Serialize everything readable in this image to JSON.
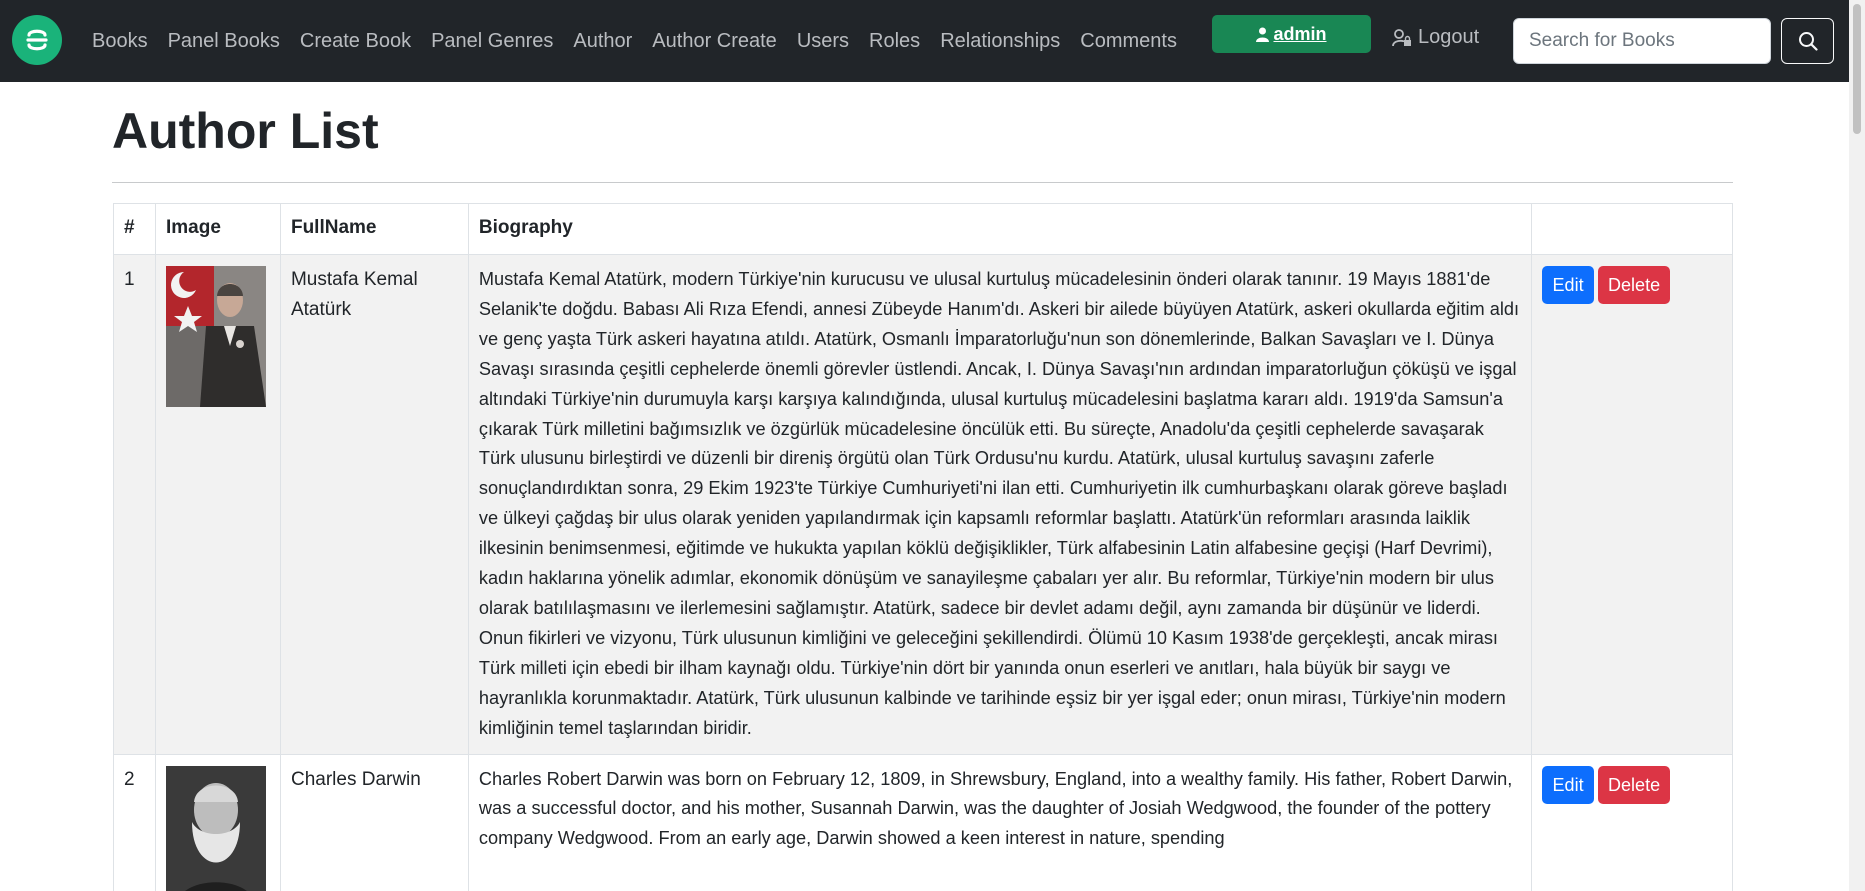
{
  "nav": {
    "brand_icon": "brand-logo-icon",
    "links": [
      "Books",
      "Panel Books",
      "Create Book",
      "Panel Genres",
      "Author",
      "Author Create",
      "Users",
      "Roles",
      "Relationships",
      "Comments"
    ],
    "admin_label": "admin",
    "logout_label": "Logout",
    "search_placeholder": "Search for Books"
  },
  "colors": {
    "navbar": "#212529",
    "brand": "#1ab37a",
    "admin": "#198754",
    "edit": "#0d6efd",
    "delete": "#dc3545"
  },
  "page": {
    "title": "Author List"
  },
  "table": {
    "headers": [
      "#",
      "Image",
      "FullName",
      "Biography",
      ""
    ],
    "rows": [
      {
        "num": "1",
        "name": "Mustafa Kemal Atatürk",
        "bio": "Mustafa Kemal Atatürk, modern Türkiye'nin kurucusu ve ulusal kurtuluş mücadelesinin önderi olarak tanınır. 19 Mayıs 1881'de Selanik'te doğdu. Babası Ali Rıza Efendi, annesi Zübeyde Hanım'dı. Askeri bir ailede büyüyen Atatürk, askeri okullarda eğitim aldı ve genç yaşta Türk askeri hayatına atıldı. Atatürk, Osmanlı İmparatorluğu'nun son dönemlerinde, Balkan Savaşları ve I. Dünya Savaşı sırasında çeşitli cephelerde önemli görevler üstlendi. Ancak, I. Dünya Savaşı'nın ardından imparatorluğun çöküşü ve işgal altındaki Türkiye'nin durumuyla karşı karşıya kalındığında, ulusal kurtuluş mücadelesini başlatma kararı aldı. 1919'da Samsun'a çıkarak Türk milletini bağımsızlık ve özgürlük mücadelesine öncülük etti. Bu süreçte, Anadolu'da çeşitli cephelerde savaşarak Türk ulusunu birleştirdi ve düzenli bir direniş örgütü olan Türk Ordusu'nu kurdu. Atatürk, ulusal kurtuluş savaşını zaferle sonuçlandırdıktan sonra, 29 Ekim 1923'te Türkiye Cumhuriyeti'ni ilan etti. Cumhuriyetin ilk cumhurbaşkanı olarak göreve başladı ve ülkeyi çağdaş bir ulus olarak yeniden yapılandırmak için kapsamlı reformlar başlattı. Atatürk'ün reformları arasında laiklik ilkesinin benimsenmesi, eğitimde ve hukukta yapılan köklü değişiklikler, Türk alfabesinin Latin alfabesine geçişi (Harf Devrimi), kadın haklarına yönelik adımlar, ekonomik dönüşüm ve sanayileşme çabaları yer alır. Bu reformlar, Türkiye'nin modern bir ulus olarak batılılaşmasını ve ilerlemesini sağlamıştır. Atatürk, sadece bir devlet adamı değil, aynı zamanda bir düşünür ve liderdi. Onun fikirleri ve vizyonu, Türk ulusunun kimliğini ve geleceğini şekillendirdi. Ölümü 10 Kasım 1938'de gerçekleşti, ancak mirası Türk milleti için ebedi bir ilham kaynağı oldu. Türkiye'nin dört bir yanında onun eserleri ve anıtları, hala büyük bir saygı ve hayranlıkla korunmaktadır. Atatürk, Türk ulusunun kalbinde ve tarihinde eşsiz bir yer işgal eder; onun mirası, Türkiye'nin modern kimliğinin temel taşlarından biridir.",
        "edit_label": "Edit",
        "delete_label": "Delete"
      },
      {
        "num": "2",
        "name": "Charles Darwin",
        "bio": "Charles Robert Darwin was born on February 12, 1809, in Shrewsbury, England, into a wealthy family. His father, Robert Darwin, was a successful doctor, and his mother, Susannah Darwin, was the daughter of Josiah Wedgwood, the founder of the pottery company Wedgwood. From an early age, Darwin showed a keen interest in nature, spending",
        "edit_label": "Edit",
        "delete_label": "Delete"
      }
    ]
  }
}
